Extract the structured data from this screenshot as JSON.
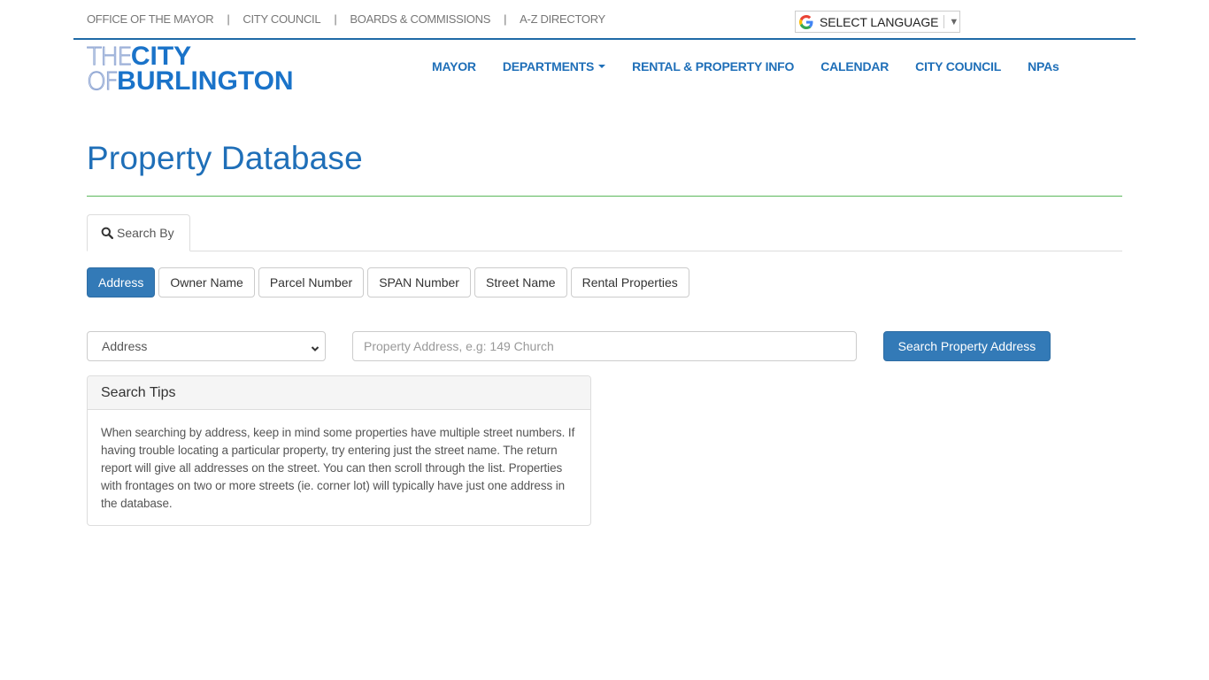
{
  "utility_nav": {
    "items": [
      "OFFICE OF THE MAYOR",
      "CITY COUNCIL",
      "BOARDS & COMMISSIONS",
      "A-Z DIRECTORY"
    ],
    "separator": "|"
  },
  "language": {
    "label": "SELECT LANGUAGE",
    "icon": "google-g-icon",
    "arrow": "▼"
  },
  "logo": {
    "line1_thin": "THE",
    "line1_bold": "CITY",
    "line2_thin": "OF",
    "line2_bold": "BURLINGTON"
  },
  "main_nav": {
    "items": [
      {
        "label": "MAYOR",
        "dropdown": false
      },
      {
        "label": "DEPARTMENTS",
        "dropdown": true
      },
      {
        "label": "RENTAL & PROPERTY INFO",
        "dropdown": false
      },
      {
        "label": "CALENDAR",
        "dropdown": false
      },
      {
        "label": "CITY COUNCIL",
        "dropdown": false
      },
      {
        "label": "NPAs",
        "dropdown": false
      }
    ]
  },
  "page": {
    "title": "Property Database"
  },
  "tabs": {
    "active_label": "Search By",
    "icon": "search-icon"
  },
  "search_types": {
    "active": "Address",
    "options": [
      "Address",
      "Owner Name",
      "Parcel Number",
      "SPAN Number",
      "Street Name",
      "Rental Properties"
    ]
  },
  "search_form": {
    "select_value": "Address",
    "input_value": "",
    "input_placeholder": "Property Address, e.g: 149 Church",
    "submit_label": "Search Property Address"
  },
  "tips_panel": {
    "heading": "Search Tips",
    "body": "When searching by address, keep in mind some properties have multiple street numbers. If having trouble locating a particular property, try entering just the street name. The return report will give all addresses on the street. You can then scroll through the list. Properties with frontages on two or more streets (ie. corner lot) will typically have just one address in the database."
  },
  "colors": {
    "brand_blue": "#1f6fb8",
    "button_primary": "#337ab7",
    "rule_green": "#5cb85c",
    "top_rule": "#1f6aa7"
  }
}
